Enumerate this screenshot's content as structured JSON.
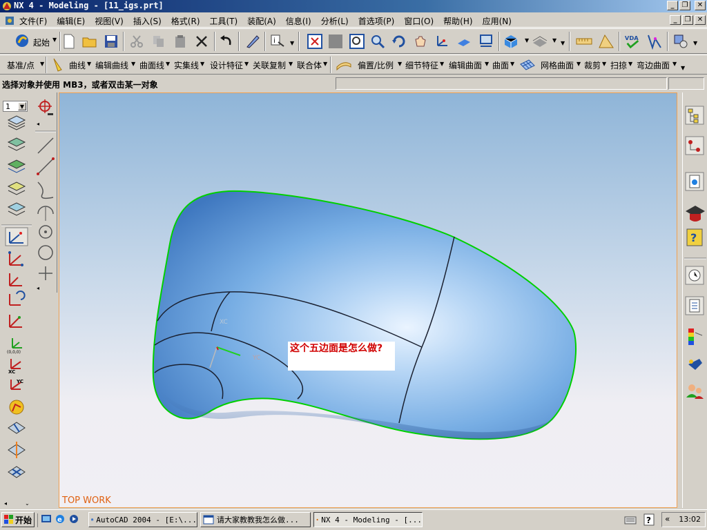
{
  "window": {
    "title": "NX 4 - Modeling - [11_igs.prt]"
  },
  "menu": {
    "items": [
      "文件(F)",
      "编辑(E)",
      "视图(V)",
      "插入(S)",
      "格式(R)",
      "工具(T)",
      "装配(A)",
      "信息(I)",
      "分析(L)",
      "首选项(P)",
      "窗口(O)",
      "帮助(H)",
      "应用(N)"
    ]
  },
  "toolbar1": {
    "start_label": "起始",
    "vda_label": "VDA"
  },
  "toolbar2": {
    "datum": "基准/点",
    "curve": "曲线",
    "edit_curve": "编辑曲线",
    "curve_from_curves": "曲面线",
    "solid_line": "实集线",
    "design_feature": "设计特征",
    "assoc_copy": "关联复制",
    "combine": "联合体",
    "offset_scale": "偏置/比例",
    "detail_feature": "细节特征",
    "edit_surface": "编辑曲面",
    "surface": "曲面",
    "mesh_surface": "网格曲面",
    "trim": "裁剪",
    "sweep": "扫掠",
    "flange_surface": "弯边曲面"
  },
  "status": {
    "prompt": "选择对象并使用 MB3，或者双击某一对象"
  },
  "layer": {
    "value": "1"
  },
  "viewport": {
    "label": "TOP WORK",
    "yc_label": "YC",
    "xc_label": "XC"
  },
  "annotation": {
    "text": "这个五边面是怎么做?"
  },
  "taskbar": {
    "start": "开始",
    "tasks": [
      {
        "label": "AutoCAD 2004 - [E:\\..."
      },
      {
        "label": "请大家教教我怎么做..."
      },
      {
        "label": "NX 4 - Modeling - [..."
      }
    ],
    "clock": "13:02",
    "chevron": "«"
  },
  "colors": {
    "accent": "#0a246a",
    "surface_blue": "#6aa0d8",
    "edge_green": "#00d000",
    "annotation_red": "#d00000",
    "viewlabel_orange": "#e06010"
  }
}
